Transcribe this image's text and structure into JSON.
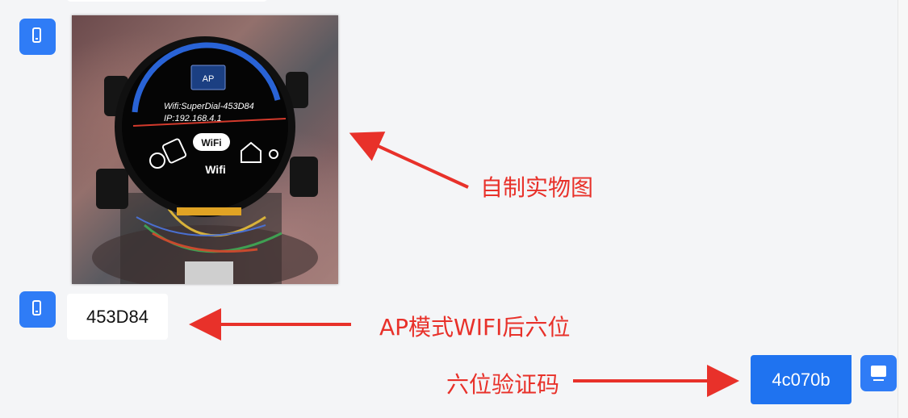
{
  "chat": {
    "incoming_text": "453D84",
    "outgoing_text": "4c070b"
  },
  "device_screen": {
    "mode_button": "AP",
    "wifi_line": "Wifi:SuperDial-453D84",
    "ip_line": "IP:192.168.4.1",
    "wifi_badge": "WiFi",
    "caption": "Wifi"
  },
  "annotations": {
    "photo_label": "自制实物图",
    "wifi_suffix_label": "AP模式WIFI后六位",
    "code_label": "六位验证码"
  },
  "colors": {
    "avatar": "#2f7cf6",
    "outgoing_bubble": "#1f73f0",
    "annotation": "#e8312a"
  },
  "icons": {
    "incoming_avatar": "phone-icon",
    "outgoing_avatar": "monitor-icon"
  }
}
